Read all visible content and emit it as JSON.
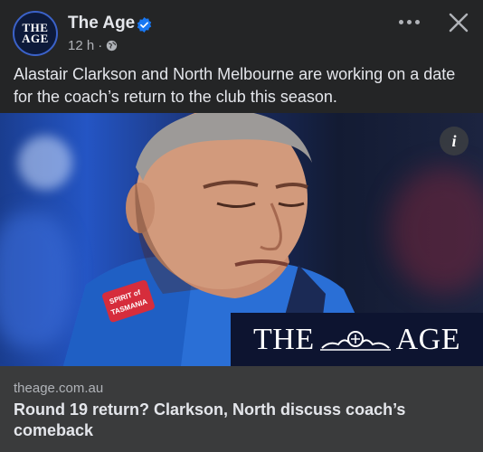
{
  "post": {
    "page_name": "The Age",
    "avatar_line1": "THE",
    "avatar_line2": "AGE",
    "timestamp": "12 h",
    "separator": "·",
    "verified": true,
    "audience_icon": "globe-icon",
    "caption": "Alastair Clarkson and North Melbourne are working on a date for the coach’s return to the club this season."
  },
  "header_actions": {
    "more_icon": "more-options-icon",
    "close_icon": "close-icon"
  },
  "media": {
    "info_label": "i",
    "brand_left": "THE",
    "brand_right": "AGE",
    "sponsor_line1": "SPIRIT of",
    "sponsor_line2": "TASMANIA"
  },
  "link_preview": {
    "domain": "theage.com.au",
    "headline": "Round 19 return? Clarkson, North discuss coach’s comeback"
  },
  "colors": {
    "background": "#242526",
    "footer": "#3a3b3c",
    "text_primary": "#e4e6eb",
    "text_secondary": "#b0b3b8",
    "verified": "#1877f2",
    "brand_box": "#0d1430"
  }
}
